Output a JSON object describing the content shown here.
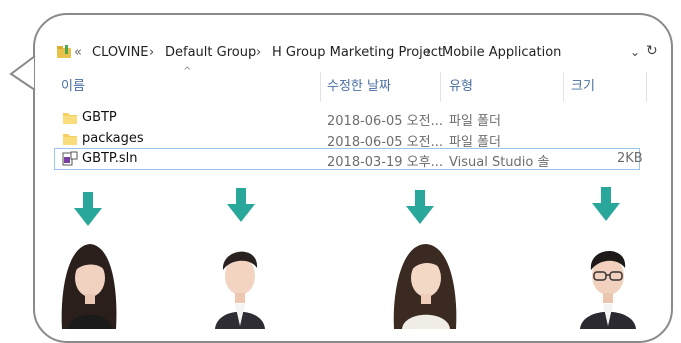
{
  "breadcrumb": {
    "overflow": "«",
    "items": [
      "CLOVINE",
      "Default Group",
      "H Group Marketing Project",
      "Mobile Application"
    ],
    "separator": "›",
    "dropdown": "⌄",
    "refresh": "↻"
  },
  "columns": {
    "name": "이름",
    "modified": "수정한 날짜",
    "type": "유형",
    "size": "크기"
  },
  "files": [
    {
      "name": "GBTP",
      "modified": "2018-06-05 오전...",
      "type": "파일 폴더",
      "size": "",
      "icon": "folder-icon"
    },
    {
      "name": "packages",
      "modified": "2018-06-05 오전...",
      "type": "파일 폴더",
      "size": "",
      "icon": "folder-icon"
    },
    {
      "name": "GBTP.sln",
      "modified": "2018-03-19 오후...",
      "type": "Visual Studio 솔",
      "size": "2KB",
      "icon": "visual-studio-solution-icon"
    }
  ],
  "colors": {
    "arrow": "#2aa79b",
    "border": "#8a8a8a",
    "header_text": "#4a6fa3",
    "selection": "#99c5ee"
  }
}
